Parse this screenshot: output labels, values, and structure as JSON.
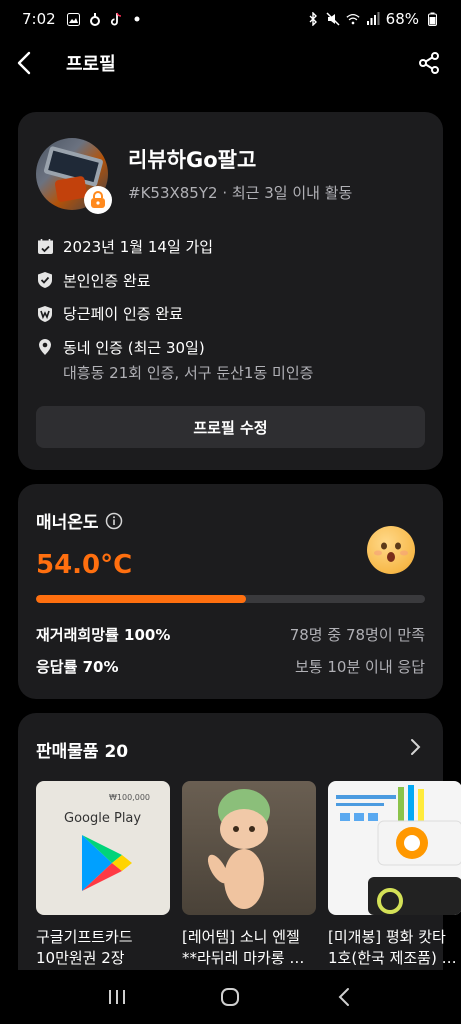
{
  "status_bar": {
    "time": "7:02",
    "battery": "68%"
  },
  "app_bar": {
    "title": "프로필"
  },
  "profile": {
    "nickname": "리뷰하Go팔고",
    "user_meta": "#K53X85Y2 · 최근 3일 이내 활동",
    "joined": "2023년 1월 14일 가입",
    "identity_verified": "본인인증 완료",
    "pay_verified": "당근페이 인증 완료",
    "neighborhood": "동네 인증 (최근 30일)",
    "neighborhood_detail": "대흥동 21회 인증, 서구 둔산1동 미인증",
    "edit_button": "프로필 수정"
  },
  "manner": {
    "title": "매너온도",
    "temperature": "54.0°C",
    "temperature_fill_percent": 54,
    "rehire_label": "재거래희망률 100%",
    "rehire_value": "78명 중 78명이 만족",
    "response_label": "응답률 70%",
    "response_value": "보통 10분 이내 응답"
  },
  "items": {
    "title": "판매물품 20",
    "list": [
      {
        "title": "구글기프트카드",
        "subtitle": "10만원권 2장"
      },
      {
        "title": "[레어템] 소니 엔젤",
        "subtitle": "**라뒤레 마카롱 시..."
      },
      {
        "title": "[미개봉] 평화 캇타",
        "subtitle": "1호(한국 제조품) 사..."
      }
    ],
    "thumb_texts": {
      "google_play": "Google Play",
      "price_tag": "₩100,000"
    }
  },
  "colors": {
    "accent": "#ff6f0f",
    "card_bg": "#1c1c1e",
    "muted_text": "#b0b0b5"
  }
}
